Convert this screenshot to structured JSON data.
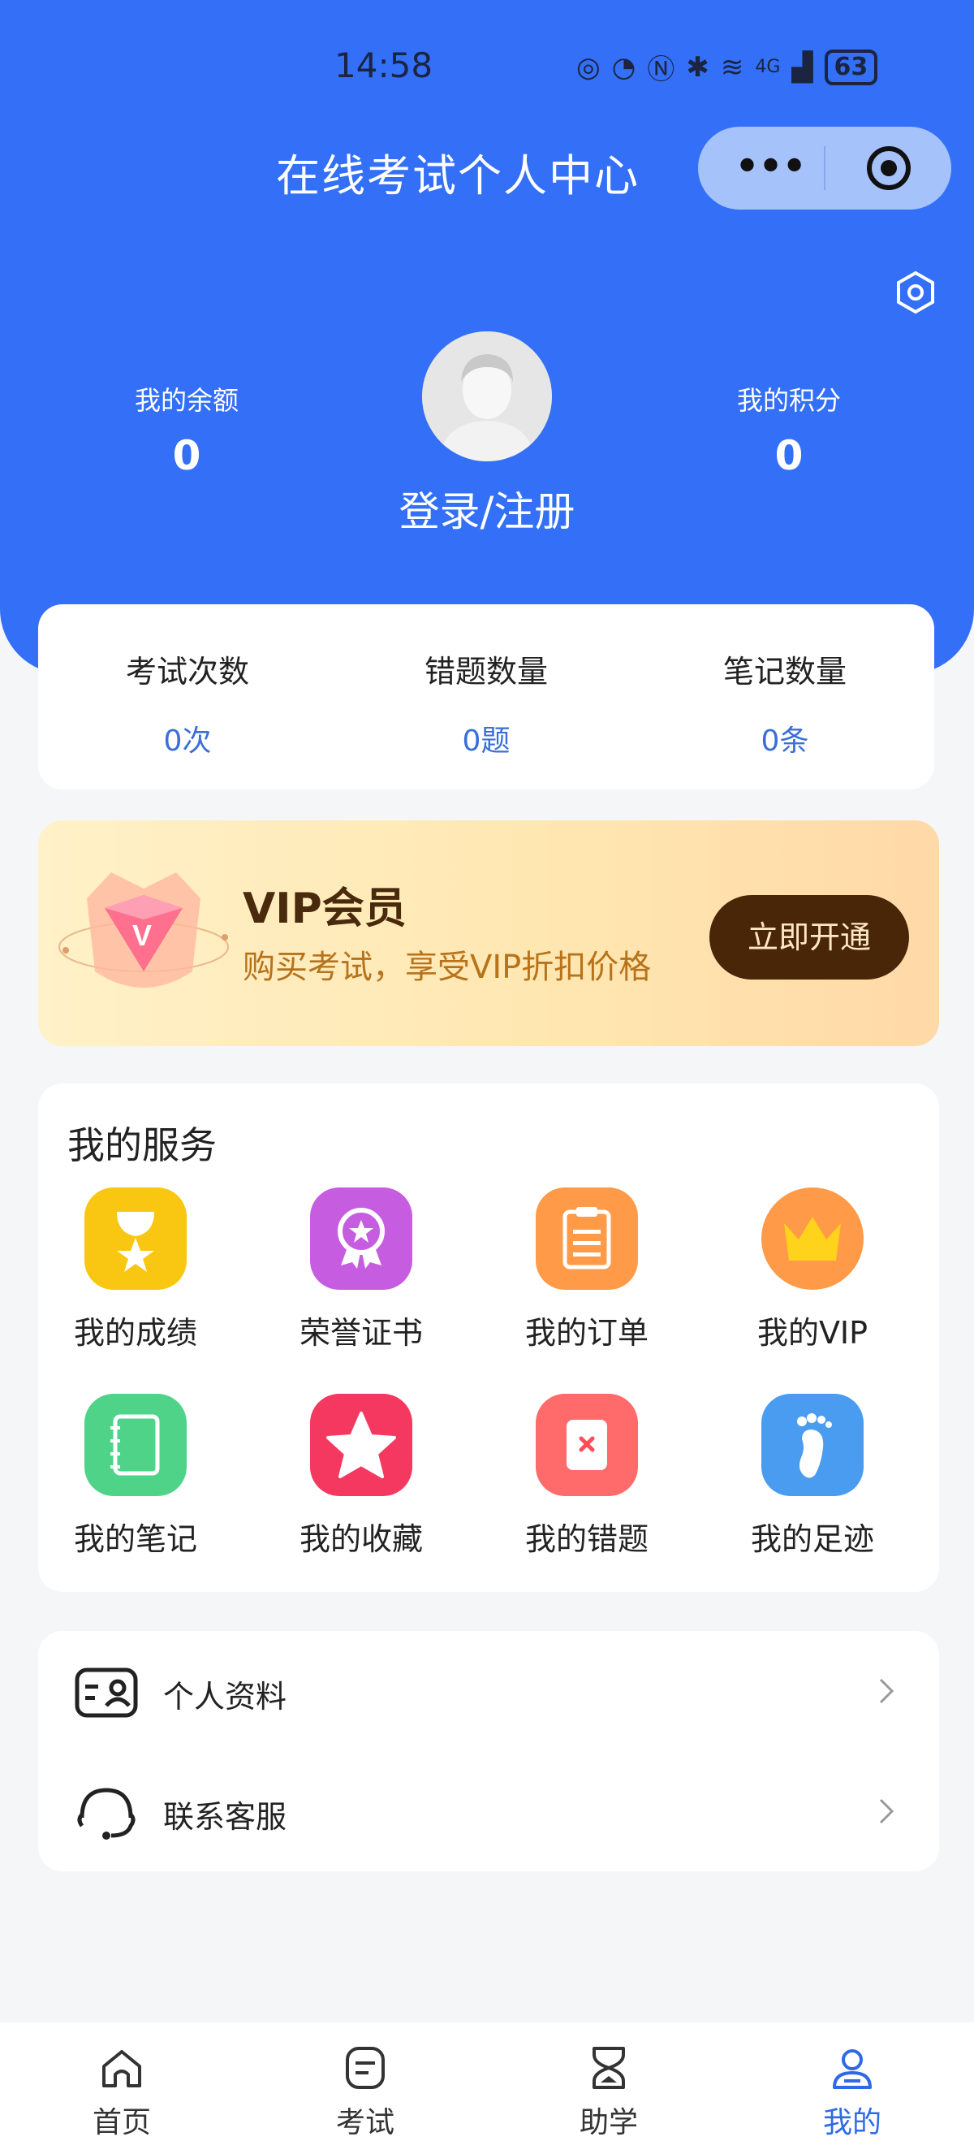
{
  "status": {
    "time": "14:58",
    "network": "4G",
    "battery": "63"
  },
  "header": {
    "title": "在线考试个人中心"
  },
  "profile": {
    "balance_label": "我的余额",
    "balance_value": "0",
    "points_label": "我的积分",
    "points_value": "0",
    "login_label": "登录/注册"
  },
  "counts": [
    {
      "label": "考试次数",
      "value": "0次"
    },
    {
      "label": "错题数量",
      "value": "0题"
    },
    {
      "label": "笔记数量",
      "value": "0条"
    }
  ],
  "vip": {
    "title": "VIP会员",
    "subtitle": "购买考试，享受VIP折扣价格",
    "button": "立即开通"
  },
  "services": {
    "title": "我的服务",
    "items": [
      {
        "label": "我的成绩",
        "icon": "medal-star-icon",
        "color": "#f9c711"
      },
      {
        "label": "荣誉证书",
        "icon": "award-ribbon-icon",
        "color": "#c65de0"
      },
      {
        "label": "我的订单",
        "icon": "clipboard-icon",
        "color": "#ff9a48"
      },
      {
        "label": "我的VIP",
        "icon": "crown-icon",
        "color": "#ff9a48"
      },
      {
        "label": "我的笔记",
        "icon": "notebook-icon",
        "color": "#4fd389"
      },
      {
        "label": "我的收藏",
        "icon": "star-icon",
        "color": "#f5385f"
      },
      {
        "label": "我的错题",
        "icon": "wrong-mark-icon",
        "color": "#ff6b6b"
      },
      {
        "label": "我的足迹",
        "icon": "footprint-icon",
        "color": "#4a9cf1"
      }
    ]
  },
  "menu": [
    {
      "label": "个人资料",
      "icon": "id-card-icon"
    },
    {
      "label": "联系客服",
      "icon": "headset-icon"
    }
  ],
  "tabs": [
    {
      "label": "首页",
      "icon": "home-icon"
    },
    {
      "label": "考试",
      "icon": "exam-icon"
    },
    {
      "label": "助学",
      "icon": "hourglass-icon"
    },
    {
      "label": "我的",
      "icon": "user-icon",
      "active": true
    }
  ],
  "colors": {
    "primary": "#3370f7",
    "accent_text": "#3a6fd8",
    "vip_button": "#4a2608"
  }
}
